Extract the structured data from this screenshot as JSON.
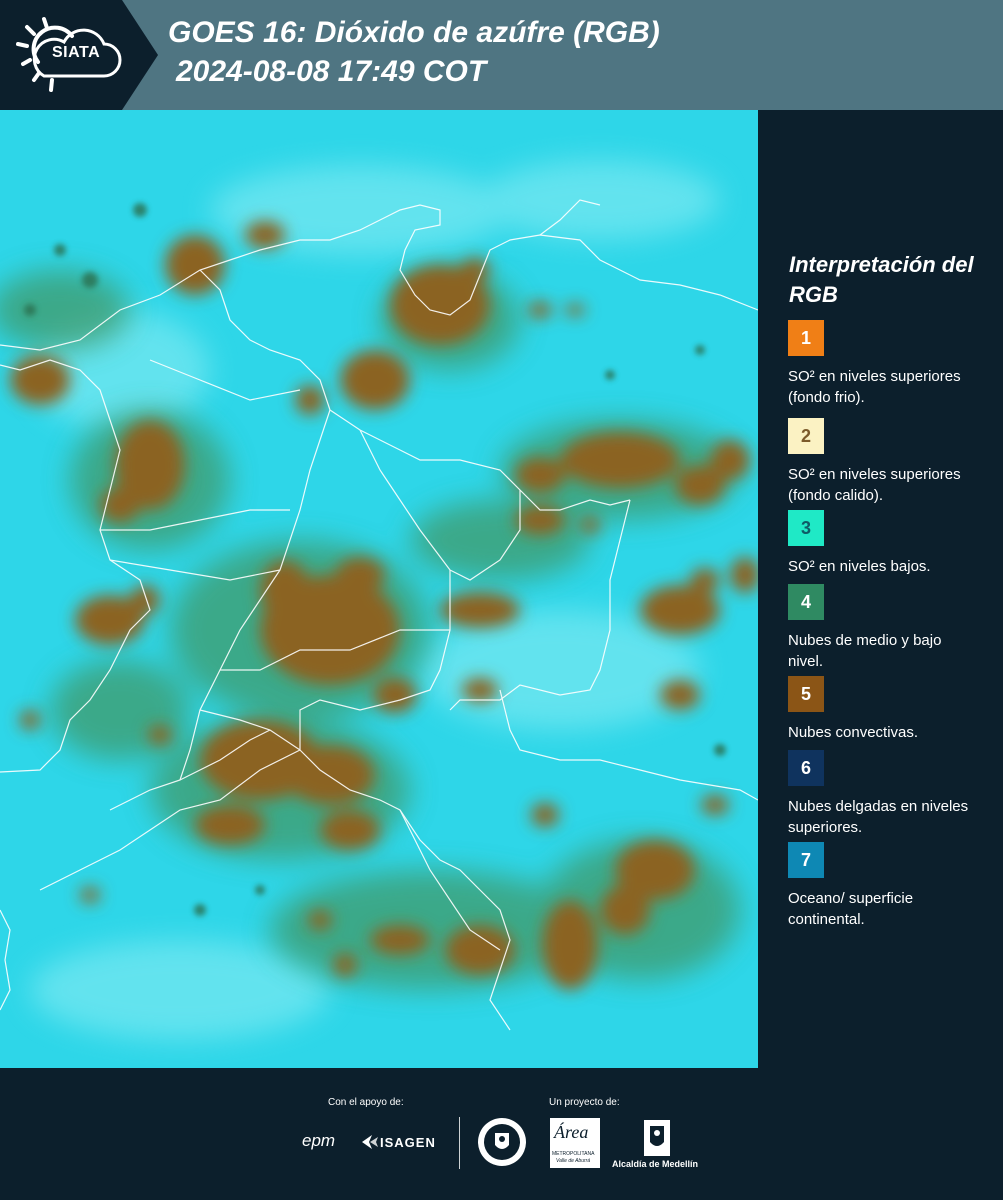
{
  "header": {
    "logo_text": "SIATA",
    "title_line1": "GOES 16: Dióxido de azúfre (RGB)",
    "title_line2": "2024-08-08 17:49 COT"
  },
  "legend": {
    "title": "Interpretación del RGB",
    "items": [
      {
        "number": "1",
        "color": "#f07f16",
        "text_color": "#ffffff",
        "label": "SO² en niveles superiores (fondo frio)."
      },
      {
        "number": "2",
        "color": "#fbf2c3",
        "text_color": "#7b5a2a",
        "label": "SO² en niveles superiores (fondo calido)."
      },
      {
        "number": "3",
        "color": "#1fe9c6",
        "text_color": "#0f5b66",
        "label": "SO² en niveles bajos."
      },
      {
        "number": "4",
        "color": "#2f8a62",
        "text_color": "#ffffff",
        "label": "Nubes de medio y bajo nivel."
      },
      {
        "number": "5",
        "color": "#8b5516",
        "text_color": "#ffffff",
        "label": "Nubes convectivas."
      },
      {
        "number": "6",
        "color": "#0f335e",
        "text_color": "#ffffff",
        "label": "Nubes delgadas en niveles superiores."
      },
      {
        "number": "7",
        "color": "#0e88b4",
        "text_color": "#ffffff",
        "label": "Oceano/ superficie continental."
      }
    ]
  },
  "footer": {
    "support_label": "Con el apoyo de:",
    "project_label": "Un proyecto de:",
    "epm_logo": "epm",
    "isagen_logo": "ISAGEN",
    "area_logo": "Área",
    "area_sub": "METROPOLITANA",
    "area_sub2": "Valle de Aburrá",
    "alcaldia_logo": "Alcaldía de Medellín"
  },
  "colors": {
    "background": "#0c1f2c",
    "header": "#4f7582",
    "surface": "#2ed6e8",
    "convective": "#8b6424"
  },
  "icons": [
    "siata-sun-cloud-icon",
    "isagen-arrow-icon",
    "medellin-seal-icon",
    "alcaldia-emblem-icon"
  ]
}
